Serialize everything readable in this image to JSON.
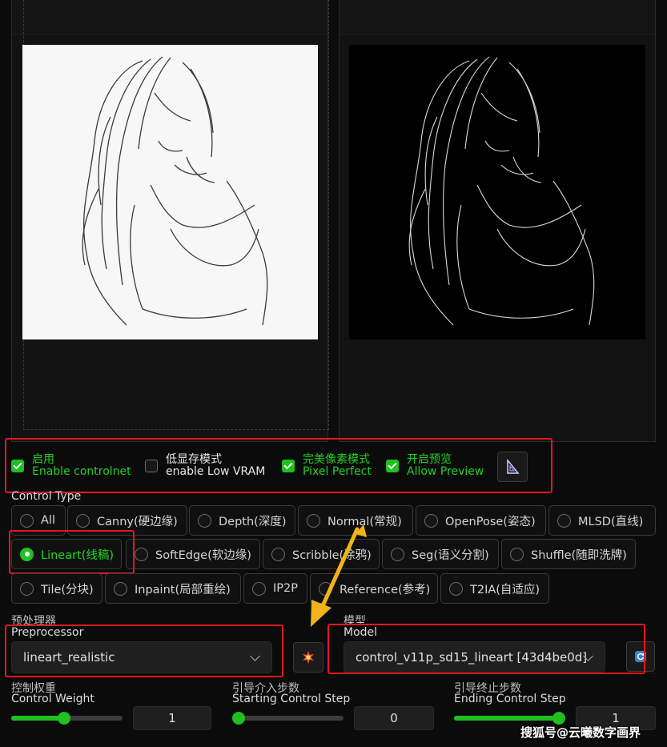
{
  "checkboxes": [
    {
      "zh": "启用",
      "en": "Enable controlnet",
      "checked": true
    },
    {
      "zh": "低显存模式",
      "en": "enable Low VRAM",
      "checked": false
    },
    {
      "zh": "完美像素模式",
      "en": "Pixel Perfect",
      "checked": true
    },
    {
      "zh": "开启预览",
      "en": "Allow Preview",
      "checked": true
    }
  ],
  "control_type": {
    "label": "Control Type",
    "options": [
      "All",
      "Canny(硬边缘)",
      "Depth(深度)",
      "Normal(常规)",
      "OpenPose(姿态)",
      "MLSD(直线)",
      "Lineart(线稿)",
      "SoftEdge(软边缘)",
      "Scribble(涂鸦)",
      "Seg(语义分割)",
      "Shuffle(随即洗牌)",
      "Tile(分块)",
      "Inpaint(局部重绘)",
      "IP2P",
      "Reference(参考)",
      "T2IA(自适应)"
    ],
    "selected": "Lineart(线稿)"
  },
  "preprocessor": {
    "label_zh": "预处理器",
    "label_en": "Preprocessor",
    "value": "lineart_realistic"
  },
  "model": {
    "label_zh": "模型",
    "label_en": "Model",
    "value": "control_v11p_sd15_lineart [43d4be0d]"
  },
  "sliders": [
    {
      "label_zh": "控制权重",
      "label_en": "Control Weight",
      "value": "1",
      "fraction": 0.47
    },
    {
      "label_zh": "引导介入步数",
      "label_en": "Starting Control Step",
      "value": "0",
      "fraction": 0.0
    },
    {
      "label_zh": "引导终止步数",
      "label_en": "Ending Control Step",
      "value": "1",
      "fraction": 1.0
    }
  ],
  "watermark": "搜狐号@云曦数字画界",
  "colors": {
    "accent": "#1fc01f",
    "annotation": "#e3171f",
    "arrow": "#f2b21a",
    "background": "#0b0b0b"
  }
}
